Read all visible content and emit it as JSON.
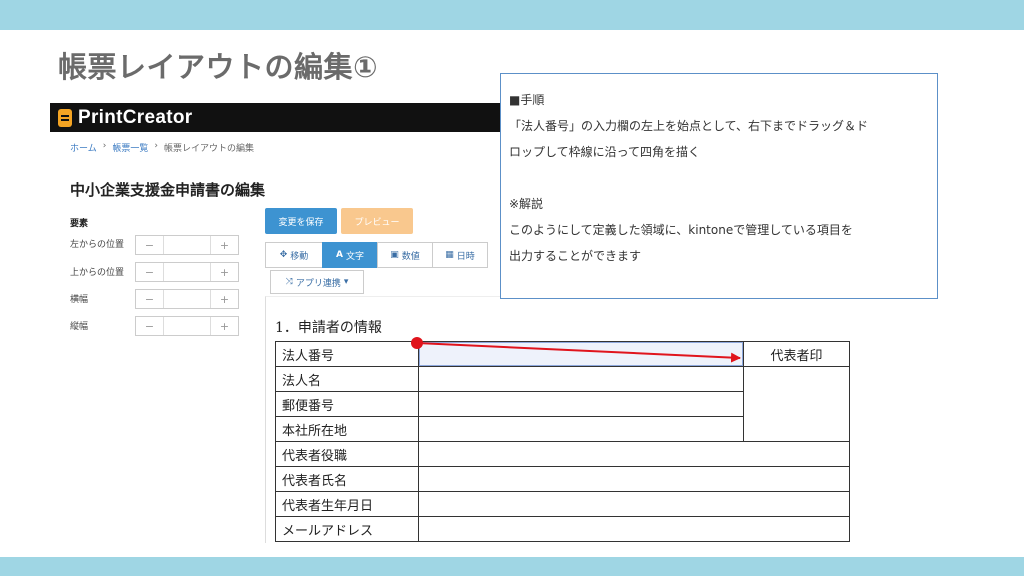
{
  "slide": {
    "title": "帳票レイアウトの編集①"
  },
  "app": {
    "logo_text": "PrintCreator",
    "breadcrumb": [
      "ホーム",
      "帳票一覧",
      "帳票レイアウトの編集"
    ],
    "form_title": "中小企業支援金申請書の編集",
    "sidebar": {
      "heading": "要素",
      "fields": [
        {
          "label": "左からの位置",
          "minus": "−",
          "plus": "+"
        },
        {
          "label": "上からの位置",
          "minus": "−",
          "plus": "+"
        },
        {
          "label": "横幅",
          "minus": "−",
          "plus": "+"
        },
        {
          "label": "縦幅",
          "minus": "−",
          "plus": "+"
        }
      ]
    },
    "buttons": {
      "save": "変更を保存",
      "preview": "プレビュー"
    },
    "toolbar": [
      {
        "label": "移動",
        "icon": "move-icon",
        "glyph": "✥"
      },
      {
        "label": "文字",
        "icon": "text-icon",
        "glyph": "A"
      },
      {
        "label": "数値",
        "icon": "number-icon",
        "glyph": "▣"
      },
      {
        "label": "日時",
        "icon": "calendar-icon",
        "glyph": "▦"
      }
    ],
    "app_link": {
      "label": "アプリ連携",
      "glyph": "⤨",
      "caret": "▾"
    }
  },
  "document": {
    "section": "1．申請者の情報",
    "rows": [
      {
        "label": "法人番号"
      },
      {
        "label": "法人名"
      },
      {
        "label": "郵便番号"
      },
      {
        "label": "本社所在地"
      },
      {
        "label": "代表者役職"
      },
      {
        "label": "代表者氏名"
      },
      {
        "label": "代表者生年月日"
      },
      {
        "label": "メールアドレス"
      }
    ],
    "seal_label": "代表者印"
  },
  "callout": {
    "heading": "■手順",
    "step_line1": "「法人番号」の入力欄の左上を始点として、右下までドラッグ＆ド",
    "step_line2": "ロップして枠線に沿って四角を描く",
    "note_heading": "※解説",
    "note_line1": "このようにして定義した領域に、kintoneで管理している項目を",
    "note_line2": "出力することができます"
  },
  "colors": {
    "band": "#9fd6e4",
    "accent_blue": "#3d93d1",
    "preview_orange": "#f9c88e",
    "arrow_red": "#e0141c",
    "callout_border": "#5c90c8"
  }
}
